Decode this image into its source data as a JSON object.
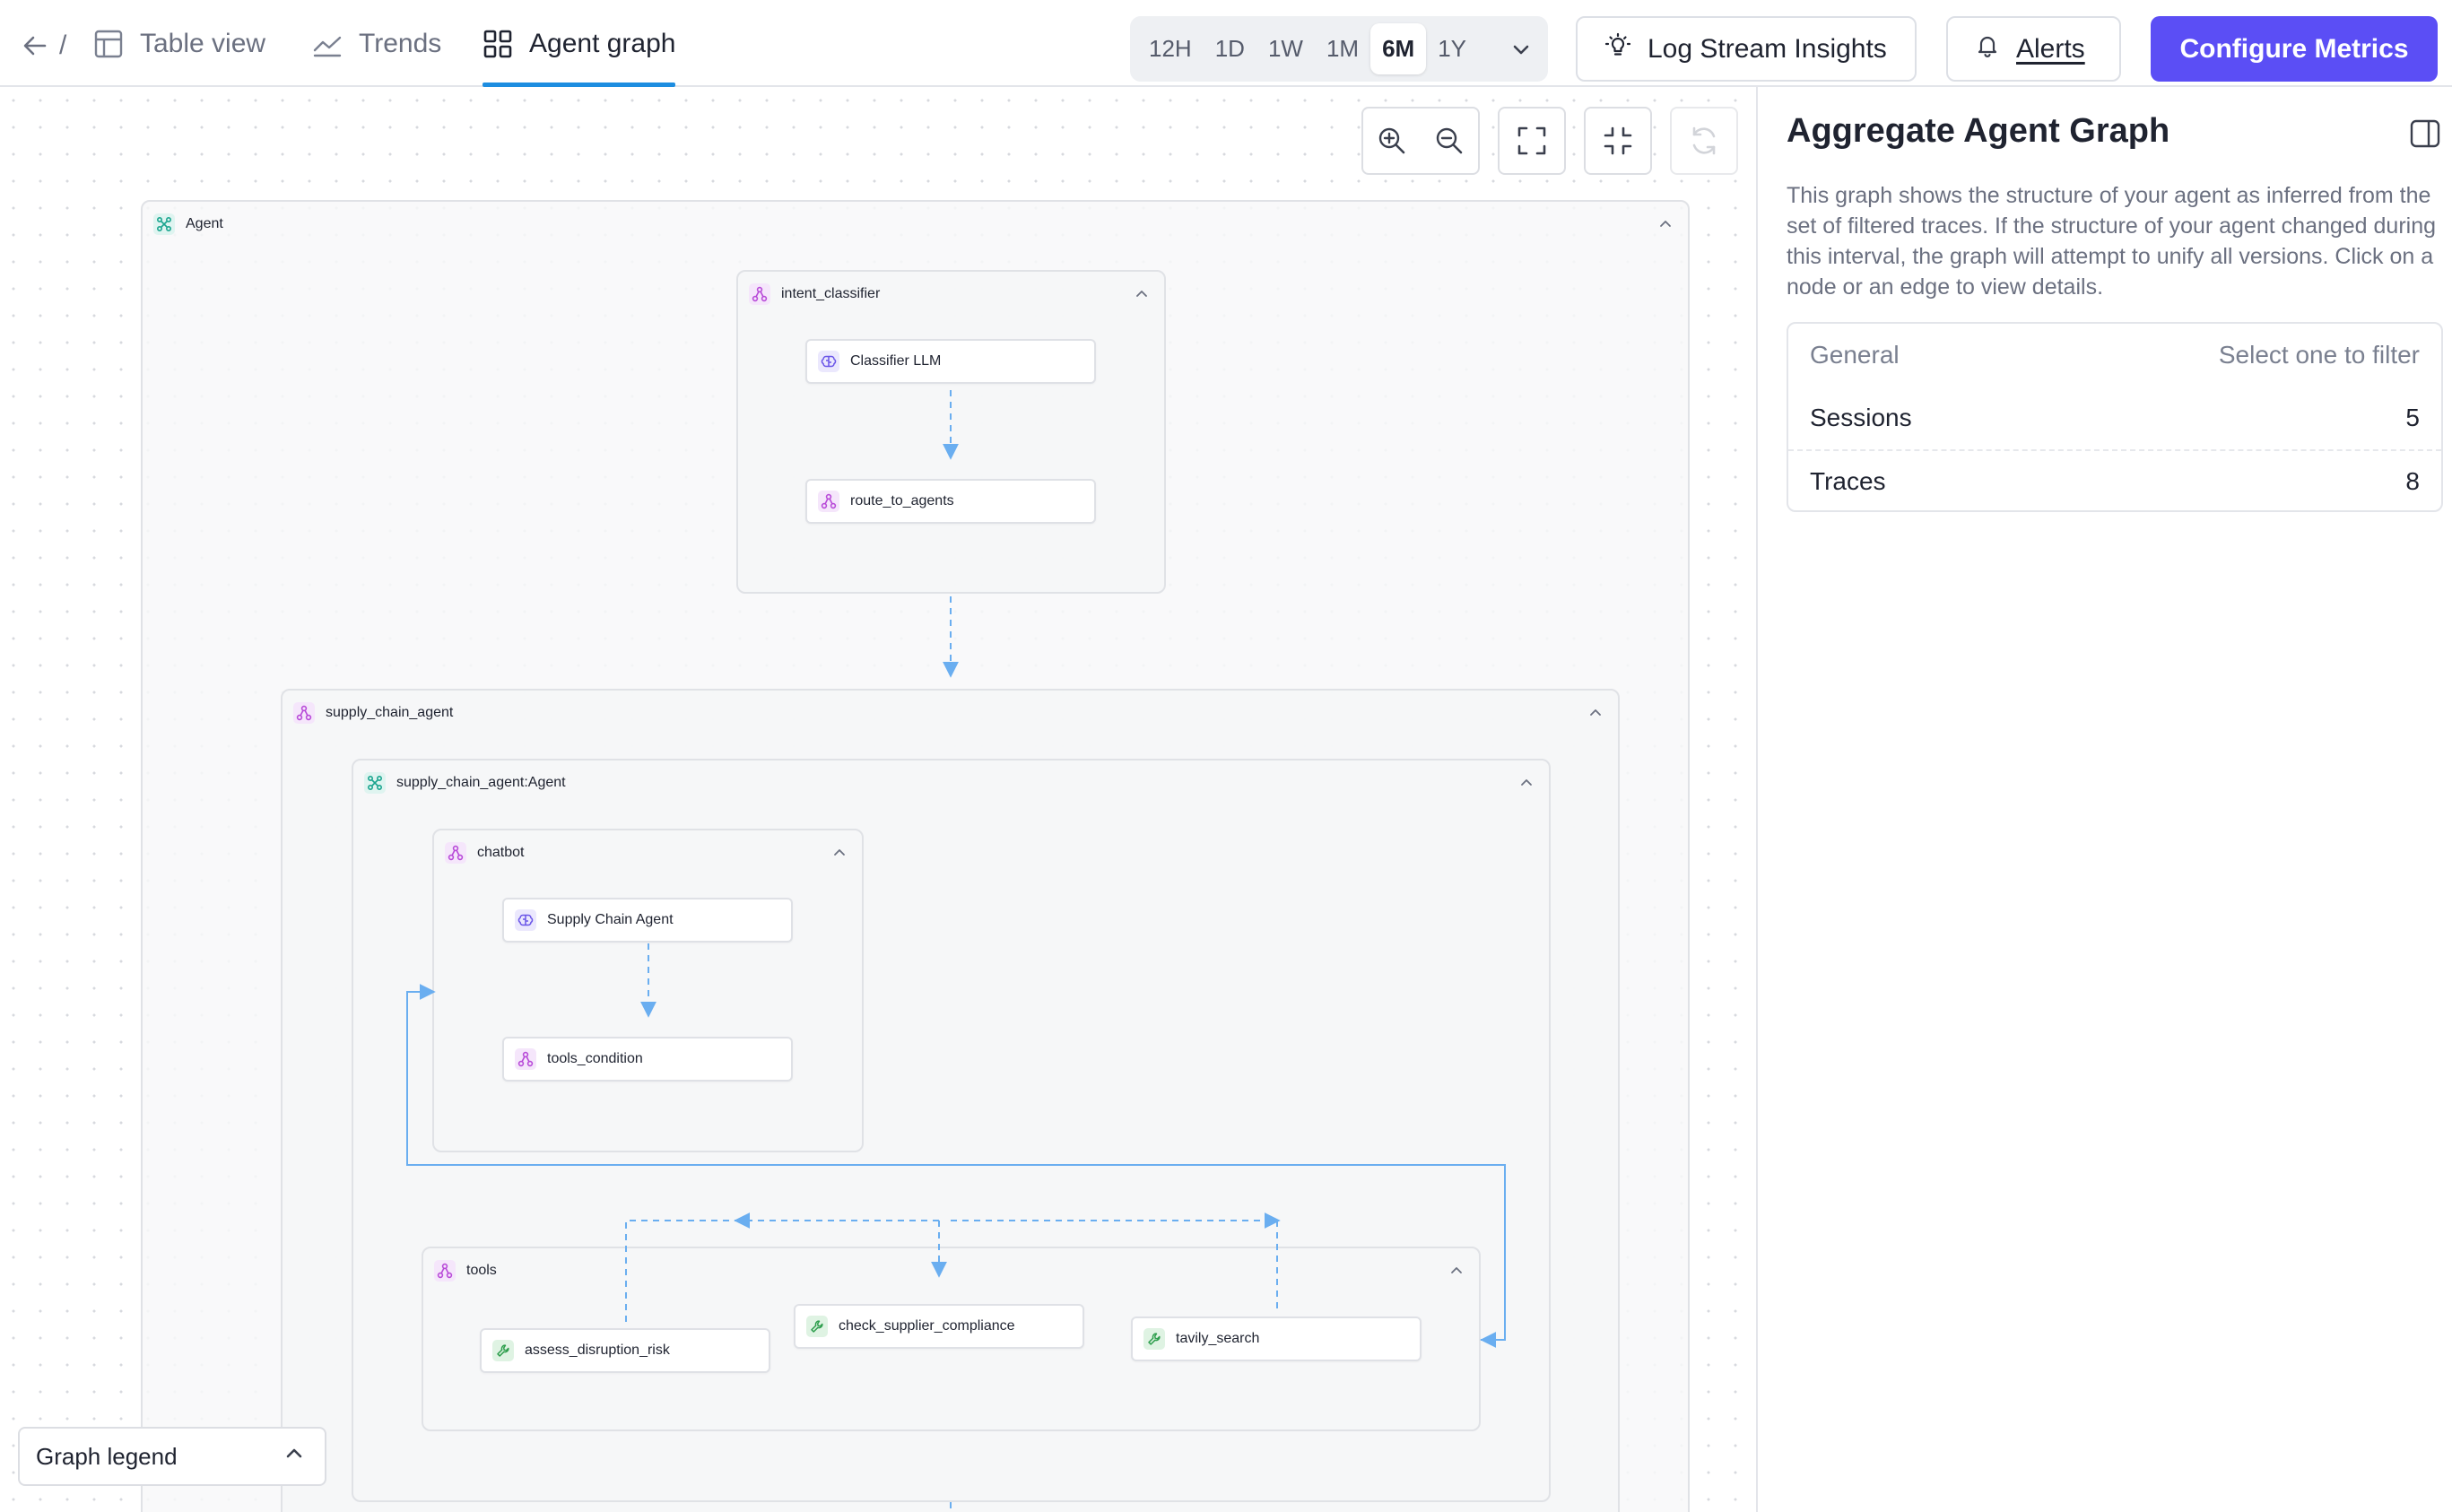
{
  "nav": {
    "breadcrumb_sep": "/",
    "tabs": [
      {
        "label": "Table view",
        "icon": "table-icon"
      },
      {
        "label": "Trends",
        "icon": "trend-line-icon"
      },
      {
        "label": "Agent graph",
        "icon": "grid-icon",
        "active": true
      }
    ]
  },
  "time_range": {
    "options": [
      "12H",
      "1D",
      "1W",
      "1M",
      "6M",
      "1Y"
    ],
    "selected": "6M"
  },
  "actions": {
    "log_stream_insights": "Log Stream Insights",
    "alerts": "Alerts",
    "configure_metrics": "Configure Metrics"
  },
  "graph": {
    "groups": {
      "agent": "Agent",
      "intent_classifier": "intent_classifier",
      "supply_chain_agent": "supply_chain_agent",
      "supply_chain_agent_agent": "supply_chain_agent:Agent",
      "chatbot": "chatbot",
      "tools": "tools"
    },
    "nodes": {
      "classifier_llm": "Classifier LLM",
      "route_to_agents": "route_to_agents",
      "supply_chain_agent_llm": "Supply Chain Agent",
      "tools_condition": "tools_condition",
      "assess_disruption_risk": "assess_disruption_risk",
      "check_supplier_compliance": "check_supplier_compliance",
      "tavily_search": "tavily_search"
    },
    "legend_label": "Graph legend"
  },
  "panel": {
    "title": "Aggregate Agent Graph",
    "description": "This graph shows the structure of your agent as inferred from the set of filtered traces. If the structure of your agent changed during this interval, the graph will attempt to unify all versions. Click on a node or an edge to view details.",
    "stats_header": {
      "label": "General",
      "action": "Select one to filter"
    },
    "stats": [
      {
        "label": "Sessions",
        "value": "5"
      },
      {
        "label": "Traces",
        "value": "8"
      }
    ]
  },
  "colors": {
    "accent": "#5b4ef5",
    "active_tab_underline": "#1d8de0",
    "edge": "#6aaef0",
    "group_icon_teal": "#1aa58f",
    "group_icon_purple": "#b84ad8",
    "llm_icon_violet": "#6a55e8",
    "tool_icon_green": "#2e9e4d"
  }
}
